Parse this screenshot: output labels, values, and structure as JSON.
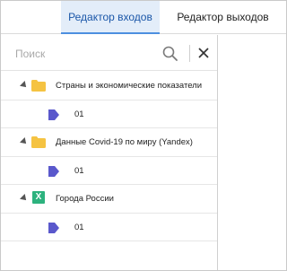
{
  "tabs": [
    {
      "label": "Редактор входов",
      "active": true
    },
    {
      "label": "Редактор выходов",
      "active": false
    }
  ],
  "search": {
    "placeholder": "Поиск",
    "value": "",
    "search_icon": "search-icon",
    "close_icon": "close-icon"
  },
  "tree": {
    "sources": [
      {
        "icon": "folder-icon",
        "label": "Страны и экономические показатели",
        "expanded": true,
        "tables": [
          {
            "icon": "table-tag-icon",
            "label": "01"
          }
        ]
      },
      {
        "icon": "folder-icon",
        "label": "Данные Covid-19 по миру (Yandex)",
        "expanded": true,
        "tables": [
          {
            "icon": "table-tag-icon",
            "label": "01"
          }
        ]
      },
      {
        "icon": "excel-icon",
        "label": "Города России",
        "expanded": true,
        "tables": [
          {
            "icon": "table-tag-icon",
            "label": "01"
          }
        ]
      }
    ]
  },
  "colors": {
    "active_tab_bg": "#e3edf9",
    "active_tab_text": "#1a56a8",
    "folder": "#f5c342",
    "excel": "#2db27e",
    "table_tag": "#5a58cc"
  }
}
